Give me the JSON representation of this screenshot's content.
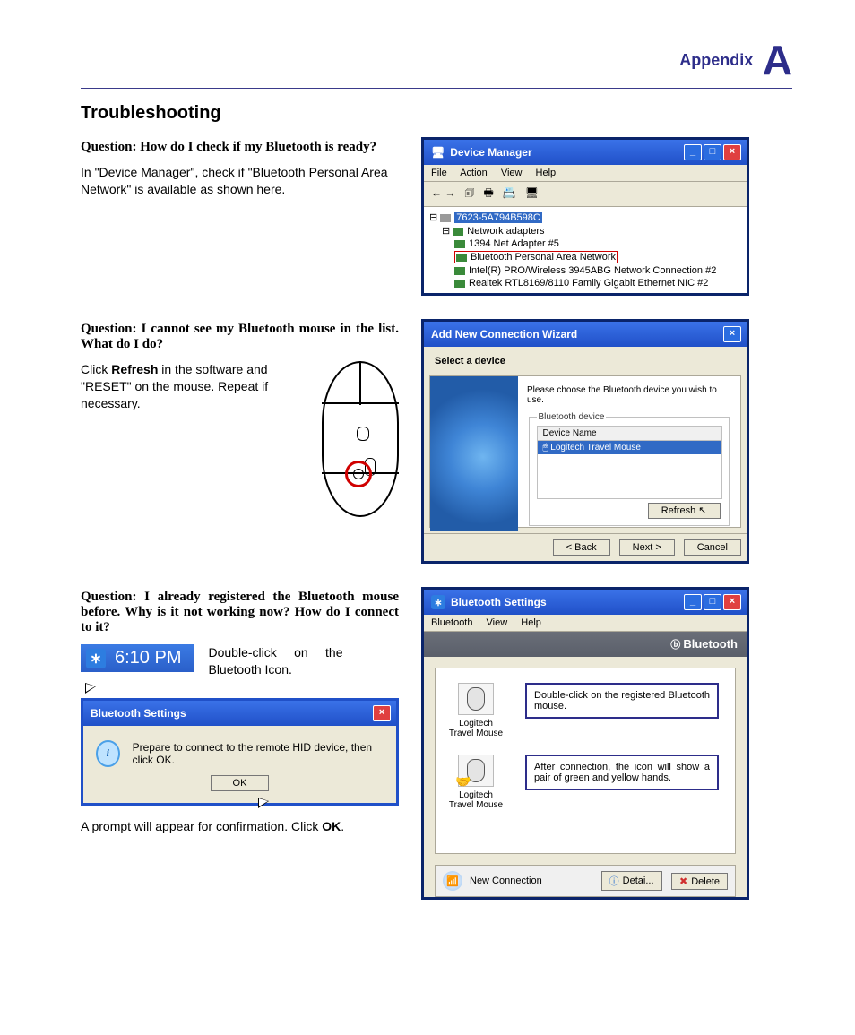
{
  "header": {
    "label": "Appendix",
    "letter": "A"
  },
  "section_title": "Troubleshooting",
  "q1": {
    "question": "Question: How do I check if my Bluetooth is ready?",
    "answer": "In \"Device Manager\", check if \"Bluetooth Personal Area Network\" is available as shown here."
  },
  "devmgr": {
    "title": "Device Manager",
    "menu": [
      "File",
      "Action",
      "View",
      "Help"
    ],
    "root": "7623-5A794B598C",
    "group": "Network adapters",
    "items": [
      "1394 Net Adapter #5",
      "Bluetooth Personal Area Network",
      "Intel(R) PRO/Wireless 3945ABG Network Connection #2",
      "Realtek RTL8169/8110 Family Gigabit Ethernet NIC #2"
    ],
    "highlight_index": 1
  },
  "q2": {
    "question": "Question: I cannot see my Bluetooth mouse in the list. What do I do?",
    "answer_pre": "Click ",
    "answer_bold": "Refresh",
    "answer_post": " in the software and \"RESET\" on the mouse. Repeat if necessary."
  },
  "wizard": {
    "title": "Add New Connection Wizard",
    "subtitle": "Select a device",
    "instruction": "Please choose the Bluetooth device you wish to use.",
    "legend": "Bluetooth device",
    "col": "Device Name",
    "device": "Logitech Travel Mouse",
    "refresh": "Refresh",
    "back": "< Back",
    "next": "Next >",
    "cancel": "Cancel"
  },
  "q3": {
    "question": "Question: I already registered the Bluetooth mouse before. Why is it not working now? How do I connect to it?",
    "clock": "6:10 PM",
    "hint": "Double-click on the Bluetooth Icon.",
    "prompt_title": "Bluetooth Settings",
    "prompt_msg": "Prepare to connect to the remote HID device, then click OK.",
    "ok": "OK",
    "confirm_pre": "A prompt will appear for confirmation. Click ",
    "confirm_bold": "OK",
    "confirm_post": "."
  },
  "btwin": {
    "title": "Bluetooth Settings",
    "menu": [
      "Bluetooth",
      "View",
      "Help"
    ],
    "band": "Bluetooth",
    "device_label": "Logitech Travel Mouse",
    "callout1": "Double-click on the registered Bluetooth mouse.",
    "callout2": "After connection, the icon will show a pair of green and yellow hands.",
    "newconn": "New Connection",
    "detail": "Detai...",
    "delete": "Delete"
  }
}
